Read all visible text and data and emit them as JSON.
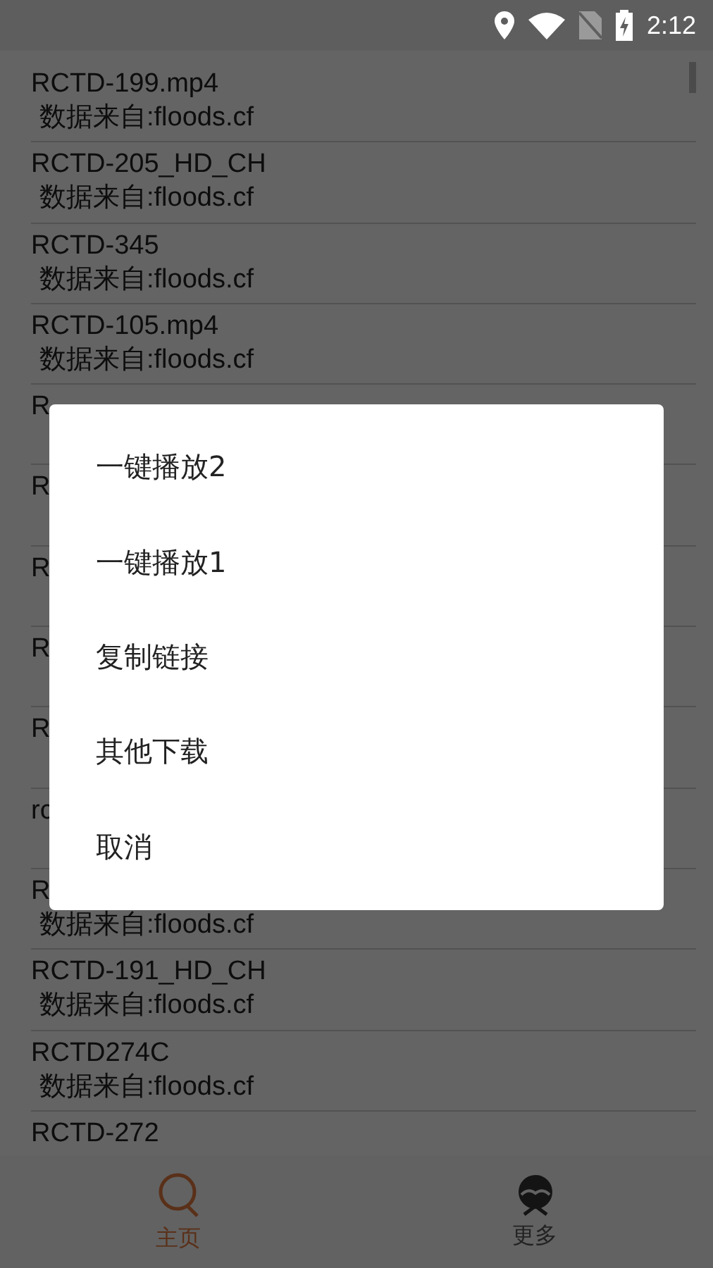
{
  "status_bar": {
    "time": "2:12"
  },
  "list": [
    {
      "title": "RCTD-199.mp4",
      "source": "数据来自:floods.cf"
    },
    {
      "title": "RCTD-205_HD_CH",
      "source": "数据来自:floods.cf"
    },
    {
      "title": "RCTD-345",
      "source": "数据来自:floods.cf"
    },
    {
      "title": "RCTD-105.mp4",
      "source": "数据来自:floods.cf"
    },
    {
      "title": "R"
    },
    {
      "title": "R"
    },
    {
      "title": "R"
    },
    {
      "title": "R"
    },
    {
      "title": "R"
    },
    {
      "title": "rc"
    },
    {
      "title": "R",
      "source": "数据来自:floods.cf"
    },
    {
      "title": "RCTD-191_HD_CH",
      "source": "数据来自:floods.cf"
    },
    {
      "title": "RCTD274C",
      "source": "数据来自:floods.cf"
    },
    {
      "title": "RCTD-272"
    }
  ],
  "bottom_nav": [
    {
      "label": "主页",
      "selected": true,
      "kind": "search"
    },
    {
      "label": "更多",
      "selected": false,
      "kind": "more"
    }
  ],
  "dialog": {
    "items": [
      "一键播放2",
      "一键播放1",
      "复制链接",
      "其他下载",
      "取消"
    ]
  }
}
